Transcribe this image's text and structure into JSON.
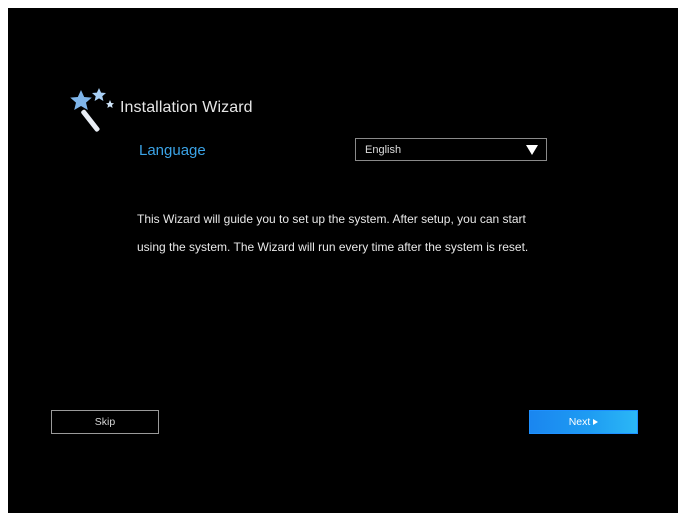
{
  "wizard": {
    "title": "Installation Wizard",
    "language_label": "Language",
    "language_select": {
      "selected": "English",
      "icon": "dropdown-arrow-icon"
    },
    "description": [
      "This Wizard will guide you to set up the system. After setup, you can start",
      "using the system. The Wizard will run every time after the system is reset."
    ],
    "skip_label": "Skip",
    "next_label": "Next",
    "next_icon": "play-icon"
  },
  "colors": {
    "background": "#000000",
    "accent": "#1e90ff",
    "label_blue": "#3ba3e6",
    "text": "#e8e8e8"
  }
}
